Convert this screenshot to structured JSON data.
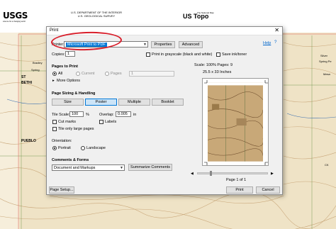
{
  "map": {
    "agency": "USGS",
    "tagline": "science for a changing world",
    "dept_line1": "U.S. DEPARTMENT OF THE INTERIOR",
    "dept_line2": "U.S. GEOLOGICAL SURVEY",
    "product_small": "The National Map",
    "product": "US Topo",
    "left_labels": [
      "Bradley",
      "Spring",
      "ST",
      "BETHI",
      "PUEBLO"
    ],
    "right_labels": [
      "Silver",
      "Spring Pe",
      "Mesa",
      "CK"
    ]
  },
  "dialog": {
    "title": "Print",
    "close": "✕",
    "help": "Help",
    "printer_label": "Printer:",
    "printer_value": "Microsoft Print to PDF",
    "properties": "Properties",
    "advanced": "Advanced",
    "copies_label": "Copies:",
    "copies_value": "1",
    "grayscale": "Print in grayscale (black and white)",
    "save_ink": "Save ink/toner",
    "pages_to_print": {
      "heading": "Pages to Print",
      "all": "All",
      "current": "Current",
      "pages": "Pages",
      "pages_value": "1",
      "more": "More Options"
    },
    "sizing": {
      "heading": "Page Sizing & Handling",
      "size": "Size",
      "poster": "Poster",
      "multiple": "Multiple",
      "booklet": "Booklet",
      "tile_scale_label": "Tile Scale:",
      "tile_scale_value": "100",
      "tile_scale_unit": "%",
      "overlap_label": "Overlap:",
      "overlap_value": "0.005",
      "overlap_unit": "in",
      "cut_marks": "Cut marks",
      "labels": "Labels",
      "tile_large": "Tile only large pages"
    },
    "orientation": {
      "heading": "Orientation:",
      "portrait": "Portrait",
      "landscape": "Landscape"
    },
    "comments": {
      "heading": "Comments & Forms",
      "value": "Document and Markups",
      "summarize": "Summarize Comments"
    },
    "preview": {
      "scale_info": "Scale: 100% Pages: 9",
      "size_info": "25.5 x 33 Inches",
      "page_info": "Page 1 of 1"
    },
    "page_setup": "Page Setup...",
    "print": "Print",
    "cancel": "Cancel"
  },
  "colors": {
    "accent": "#0078d7",
    "annotation": "#d81e2a",
    "map_tan": "#e8d9b8"
  }
}
